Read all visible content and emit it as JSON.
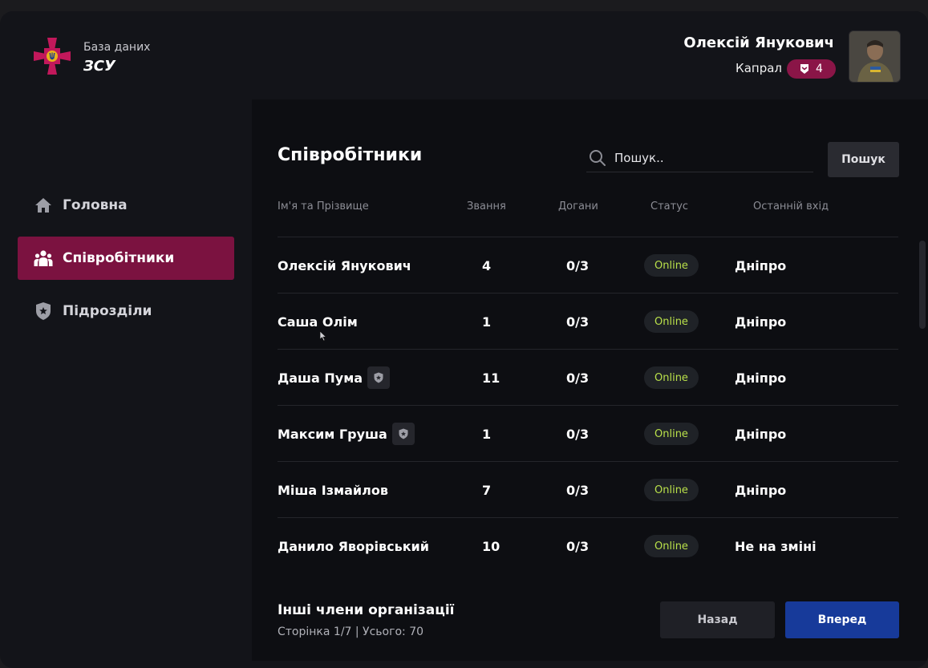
{
  "brand": {
    "subtitle": "База даних",
    "title": "ЗСУ",
    "logo_icon": "zsu-cross-emblem"
  },
  "colors": {
    "accent": "#7b1240",
    "primary_button": "#173a9a",
    "status_online": "#b9e04a",
    "background": "#131419"
  },
  "sidebar": {
    "items": [
      {
        "label": "Головна",
        "icon": "home-icon",
        "active": false
      },
      {
        "label": "Співробітники",
        "icon": "people-icon",
        "active": true
      },
      {
        "label": "Підрозділи",
        "icon": "shield-star-icon",
        "active": false
      }
    ]
  },
  "user": {
    "name": "Олексій Янукович",
    "rank": "Капрал",
    "rank_level": "4"
  },
  "main": {
    "title": "Співробітники",
    "search": {
      "placeholder": "Пошук..",
      "value": "",
      "button": "Пошук"
    },
    "columns": [
      "Ім'я та Прізвище",
      "Звання",
      "Догани",
      "Статус",
      "Останній вхід"
    ],
    "rows": [
      {
        "name": "Олексій Янукович",
        "rank": "4",
        "warnings": "0/3",
        "status": "Online",
        "last_login": "Дніпро",
        "badge": false
      },
      {
        "name": "Саша Олім",
        "rank": "1",
        "warnings": "0/3",
        "status": "Online",
        "last_login": "Дніпро",
        "badge": false
      },
      {
        "name": "Даша Пума",
        "rank": "11",
        "warnings": "0/3",
        "status": "Online",
        "last_login": "Дніпро",
        "badge": true
      },
      {
        "name": "Максим Груша",
        "rank": "1",
        "warnings": "0/3",
        "status": "Online",
        "last_login": "Дніпро",
        "badge": true
      },
      {
        "name": "Міша Ізмайлов",
        "rank": "7",
        "warnings": "0/3",
        "status": "Online",
        "last_login": "Дніпро",
        "badge": false
      },
      {
        "name": "Данило Яворівський",
        "rank": "10",
        "warnings": "0/3",
        "status": "Online",
        "last_login": "Не на зміні",
        "badge": false
      }
    ],
    "footer": {
      "title": "Інші члени організації",
      "pagination": "Сторінка 1/7 | Усього: 70",
      "back_label": "Назад",
      "next_label": "Вперед"
    }
  }
}
